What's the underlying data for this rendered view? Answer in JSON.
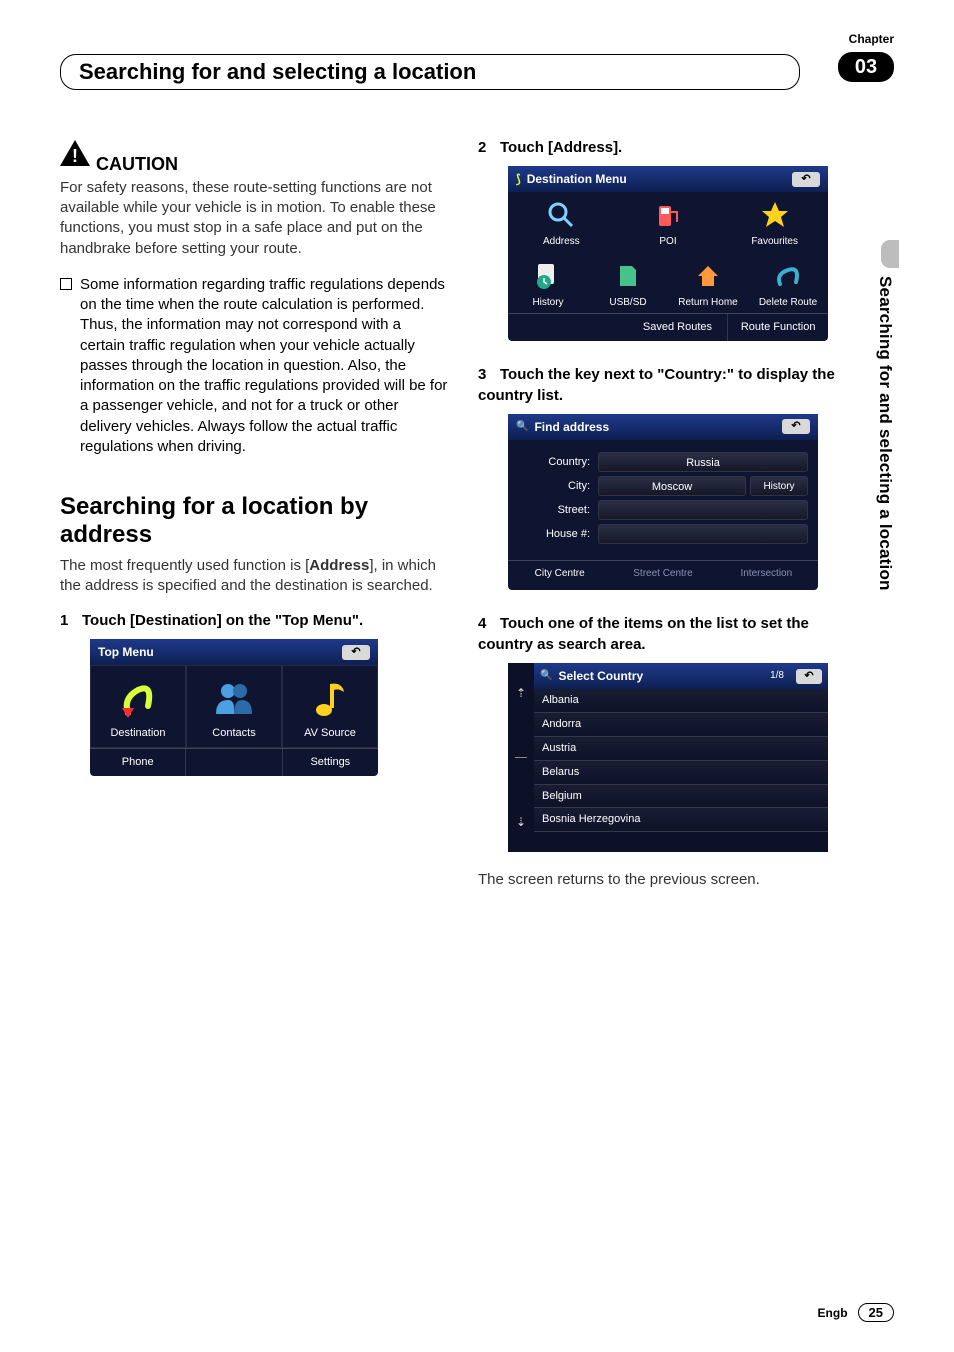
{
  "header": {
    "chapter_word": "Chapter",
    "chapter_num": "03",
    "title": "Searching for and selecting a location",
    "side_label": "Searching for and selecting a location"
  },
  "col1": {
    "caution": "CAUTION",
    "caution_body": "For safety reasons, these route-setting functions are not available while your vehicle is in motion. To enable these functions, you must stop in a safe place and put on the handbrake before setting your route.",
    "bullet": "Some information regarding traffic regulations depends on the time when the route calculation is performed. Thus, the information may not correspond with a certain traffic regulation when your vehicle actually passes through the location in question. Also, the information on the traffic regulations provided will be for a passenger vehicle, and not for a truck or other delivery vehicles. Always follow the actual traffic regulations when driving.",
    "h2": "Searching for a location by address",
    "intro_a": "The most frequently used function is [",
    "intro_b": "Address",
    "intro_c": "], in which the address is specified and the destination is searched.",
    "step1_num": "1",
    "step1": "Touch [Destination] on the \"Top Menu\"."
  },
  "topmenu": {
    "title": "Top Menu",
    "items": [
      "Destination",
      "Contacts",
      "AV Source"
    ],
    "bottom": [
      "Phone",
      "",
      "Settings"
    ]
  },
  "col2": {
    "step2_num": "2",
    "step2": "Touch [Address].",
    "step3_num": "3",
    "step3": "Touch the key next to \"Country:\" to display the country list.",
    "step4_num": "4",
    "step4": "Touch one of the items on the list to set the country as search area.",
    "return_text": "The screen returns to the previous screen."
  },
  "destmenu": {
    "title": "Destination Menu",
    "row1": [
      "Address",
      "POI",
      "Favourites"
    ],
    "row2": [
      "History",
      "USB/SD",
      "Return Home",
      "Delete Route"
    ],
    "bottom": [
      "Saved Routes",
      "Route Function"
    ]
  },
  "findaddr": {
    "title": "Find address",
    "country_label": "Country:",
    "country_value": "Russia",
    "city_label": "City:",
    "city_value": "Moscow",
    "history": "History",
    "street_label": "Street:",
    "house_label": "House #:",
    "tabs": [
      "City Centre",
      "Street Centre",
      "Intersection"
    ]
  },
  "selcountry": {
    "title": "Select Country",
    "page": "1/8",
    "items": [
      "Albania",
      "Andorra",
      "Austria",
      "Belarus",
      "Belgium",
      "Bosnia Herzegovina"
    ]
  },
  "footer": {
    "lang": "Engb",
    "page": "25"
  }
}
